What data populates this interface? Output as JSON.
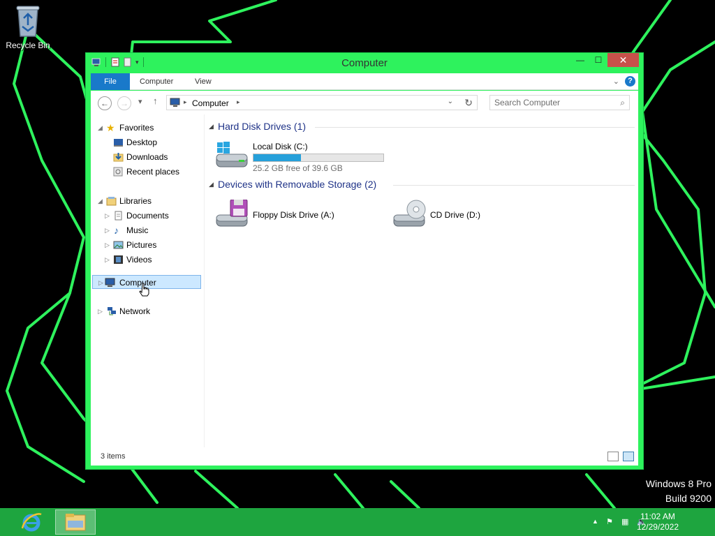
{
  "desktop": {
    "recycle_bin_label": "Recycle Bin",
    "watermark_line1": "Windows 8 Pro",
    "watermark_line2": "Build 9200",
    "background_color": "#000000",
    "wallpaper_line_color": "#2ef25d"
  },
  "window": {
    "title": "Computer",
    "accent_color": "#2ef25d",
    "controls": [
      "minimize-icon",
      "maximize-icon",
      "close-icon"
    ],
    "ribbon_tabs": {
      "file": "File",
      "computer": "Computer",
      "view": "View"
    },
    "address": {
      "crumb": "Computer"
    },
    "search": {
      "placeholder": "Search Computer"
    },
    "nav": {
      "favorites": "Favorites",
      "desktop": "Desktop",
      "downloads": "Downloads",
      "recent": "Recent places",
      "libraries": "Libraries",
      "documents": "Documents",
      "music": "Music",
      "pictures": "Pictures",
      "videos": "Videos",
      "computer": "Computer",
      "network": "Network"
    },
    "groups": {
      "hdd": {
        "title": "Hard Disk Drives (1)",
        "drives": [
          {
            "name": "Local Disk (C:)",
            "free_text": "25.2 GB free of 39.6 GB",
            "used_fraction": 0.364
          }
        ]
      },
      "removable": {
        "title": "Devices with Removable Storage (2)",
        "drives": [
          {
            "name": "Floppy Disk Drive (A:)"
          },
          {
            "name": "CD Drive (D:)"
          }
        ]
      }
    },
    "status": {
      "item_count": "3 items"
    }
  },
  "taskbar": {
    "color": "#1ea53f",
    "apps": [
      "internet-explorer-icon",
      "file-explorer-icon"
    ],
    "clock": {
      "time": "11:02 AM",
      "date": "12/29/2022"
    }
  }
}
